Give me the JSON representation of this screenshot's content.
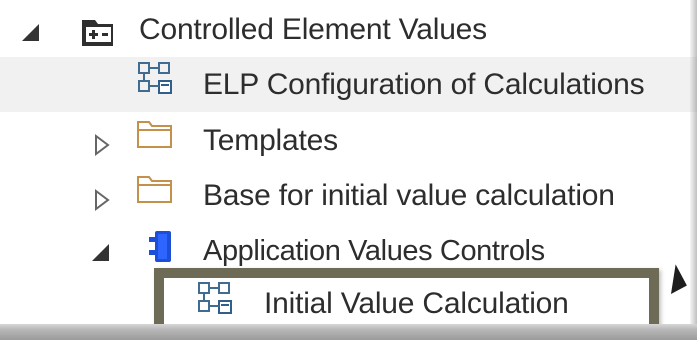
{
  "tree": {
    "items": [
      {
        "label": "Controlled Element Values",
        "icon": "package-folder-icon",
        "toggle": "expanded-arrow-icon"
      },
      {
        "label": "ELP Configuration of Calculations",
        "icon": "diagram-icon"
      },
      {
        "label": "Templates",
        "icon": "folder-icon",
        "toggle": "collapsed-arrow-icon"
      },
      {
        "label": "Base for initial value calculation",
        "icon": "folder-icon",
        "toggle": "collapsed-arrow-icon"
      },
      {
        "label": "Application Values Controls",
        "icon": "component-icon",
        "toggle": "expanded-arrow-icon"
      },
      {
        "label": "Initial Value Calculation",
        "icon": "diagram-icon"
      }
    ]
  },
  "colors": {
    "text": "#2d2d2d",
    "selected_row": "#f1f1f1",
    "folder_outline": "#c4914c",
    "component_blue": "#1d4ed8",
    "diagram_blue": "#406c92",
    "callout_border": "#6d6a55"
  }
}
